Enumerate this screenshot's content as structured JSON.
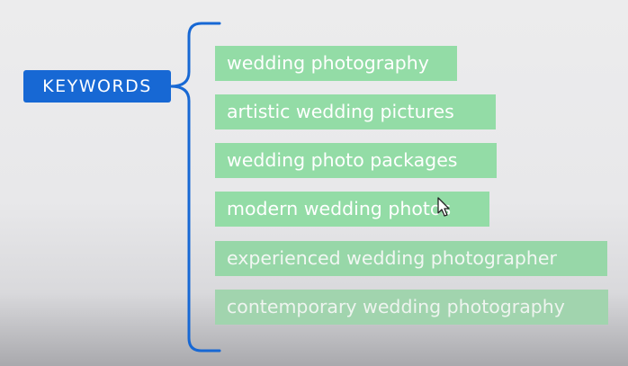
{
  "diagram": {
    "root_label": "KEYWORDS",
    "keywords": [
      "wedding photography",
      "artistic wedding pictures",
      "wedding photo packages",
      "modern wedding photos",
      "experienced wedding photographer",
      "contemporary wedding photography"
    ]
  },
  "colors": {
    "root_fill": "#1768d4",
    "brace_stroke": "#1768d4",
    "chip_fill": "#93dca6",
    "chip_text": "#ffffff",
    "background": "#ececed"
  },
  "icons": {
    "cursor": "mouse-pointer-icon"
  }
}
